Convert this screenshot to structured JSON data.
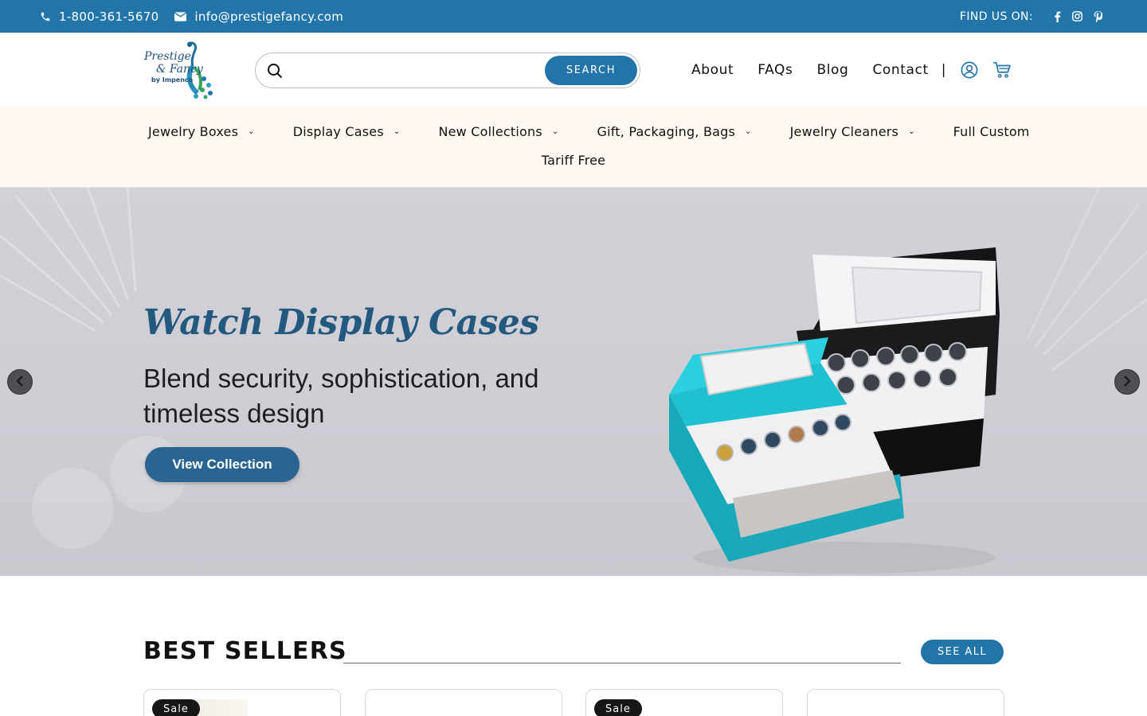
{
  "topbar": {
    "phone": "1-800-361-5670",
    "email": "info@prestigefancy.com",
    "find_us": "FIND US ON:",
    "social_icons": [
      "facebook-icon",
      "instagram-icon",
      "pinterest-icon"
    ],
    "bg_color": "#2275a8"
  },
  "logo": {
    "line1": "Prestige",
    "line2": "& Fancy",
    "line3": "by Impenco"
  },
  "search": {
    "placeholder": "",
    "value": "",
    "button_label": "SEARCH"
  },
  "header_nav": {
    "items": [
      "About",
      "FAQs",
      "Blog",
      "Contact"
    ],
    "separator": "|",
    "icons": [
      "account-icon",
      "cart-icon"
    ]
  },
  "category_nav": {
    "row1": [
      {
        "label": "Jewelry Boxes",
        "dropdown": true
      },
      {
        "label": "Display Cases",
        "dropdown": true
      },
      {
        "label": "New Collections",
        "dropdown": true
      },
      {
        "label": "Gift, Packaging, Bags",
        "dropdown": true
      },
      {
        "label": "Jewelry Cleaners",
        "dropdown": true
      },
      {
        "label": "Full Custom",
        "dropdown": false
      }
    ],
    "row2": "Tariff Free",
    "bg_color": "#fff9f2"
  },
  "hero": {
    "title": "Watch Display Cases",
    "subtitle": "Blend security, sophistication, and timeless design",
    "cta": "View Collection",
    "prev_icon": "chevron-left-icon",
    "next_icon": "chevron-right-icon",
    "accent_color": "#23587f"
  },
  "best_sellers": {
    "title": "BEST SELLERS",
    "see_all": "SEE ALL",
    "cards": [
      {
        "badge": "Sale"
      },
      {
        "badge": ""
      },
      {
        "badge": "Sale"
      },
      {
        "badge": ""
      }
    ]
  }
}
